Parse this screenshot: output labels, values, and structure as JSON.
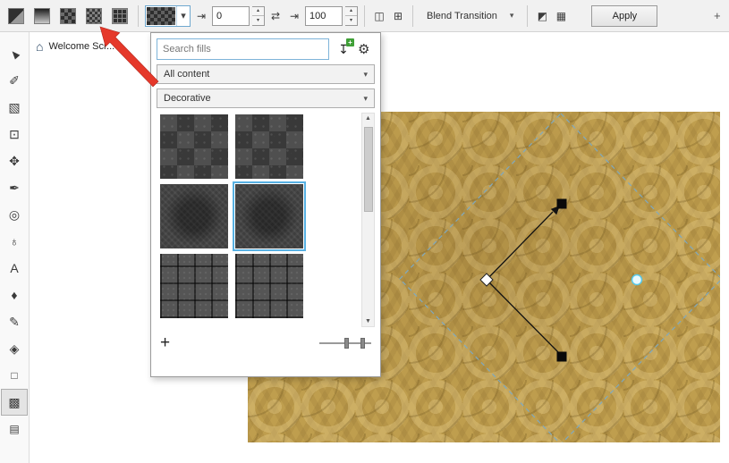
{
  "colors": {
    "accent_blue": "#57b1e3",
    "annotation_red": "#e5382a",
    "canvas_gold": "#bf9e4e",
    "selection_dash": "#7fa9bf"
  },
  "toolbar": {
    "fill_type_icons": [
      {
        "name": "uniform-fill"
      },
      {
        "name": "fountain-fill"
      },
      {
        "name": "vector-pattern-fill"
      },
      {
        "name": "bitmap-pattern-fill"
      },
      {
        "name": "texture-fill"
      }
    ],
    "swatch_arrow": "▾",
    "offset_icon": "⇥",
    "offset_value": "0",
    "mirror_icon": "⇄",
    "scale_icon": "⇥",
    "scale_value": "100",
    "tile_icon_1": "◫",
    "tile_icon_2": "⊞",
    "blend_transition": {
      "label": "Blend Transition",
      "arrow": "▾"
    },
    "extra_icon_1": "◩",
    "extra_icon_2": "▦",
    "apply_label": "Apply",
    "overflow_icon": "+",
    "spin_up": "▴",
    "spin_down": "▾"
  },
  "document_tab": {
    "home_icon": "⌂",
    "label": "Welcome Scr..."
  },
  "toolbox": {
    "tools": [
      {
        "name": "pick-tool",
        "glyph": "▲"
      },
      {
        "name": "shape-tool",
        "glyph": "✐"
      },
      {
        "name": "freehand-pick-tool",
        "glyph": "▧"
      },
      {
        "name": "crop-tool",
        "glyph": "⊡"
      },
      {
        "name": "pan-tool",
        "glyph": "✥"
      },
      {
        "name": "artistic-media-tool",
        "glyph": "✒"
      },
      {
        "name": "spiral-tool",
        "glyph": "◎"
      },
      {
        "name": "basic-shapes-tool",
        "glyph": "♁"
      },
      {
        "name": "text-tool",
        "glyph": "A"
      },
      {
        "name": "ink-tool",
        "glyph": "♦"
      },
      {
        "name": "pen-tool",
        "glyph": "✎"
      },
      {
        "name": "smart-fill-tool",
        "glyph": "◈"
      },
      {
        "name": "outline-tool",
        "glyph": "□"
      },
      {
        "name": "pattern-fill-tool",
        "glyph": "▩"
      },
      {
        "name": "extra-tool",
        "glyph": "▤"
      }
    ]
  },
  "fill_picker": {
    "search_placeholder": "Search fills",
    "import_icon": "↧",
    "import_badge": "+",
    "settings_icon": "⚙",
    "content_filter": "All content",
    "category_filter": "Decorative",
    "filter_arrow": "▾",
    "thumbnails": [
      {
        "id": "checker-pattern-1",
        "selected": false
      },
      {
        "id": "checker-pattern-2",
        "selected": false
      },
      {
        "id": "weave-pattern-1",
        "selected": false
      },
      {
        "id": "weave-pattern-2",
        "selected": true
      },
      {
        "id": "grid-pattern-1",
        "selected": false
      },
      {
        "id": "grid-pattern-2",
        "selected": false
      }
    ],
    "add_icon": "+",
    "scroll_up": "▲",
    "scroll_down": "▼"
  }
}
